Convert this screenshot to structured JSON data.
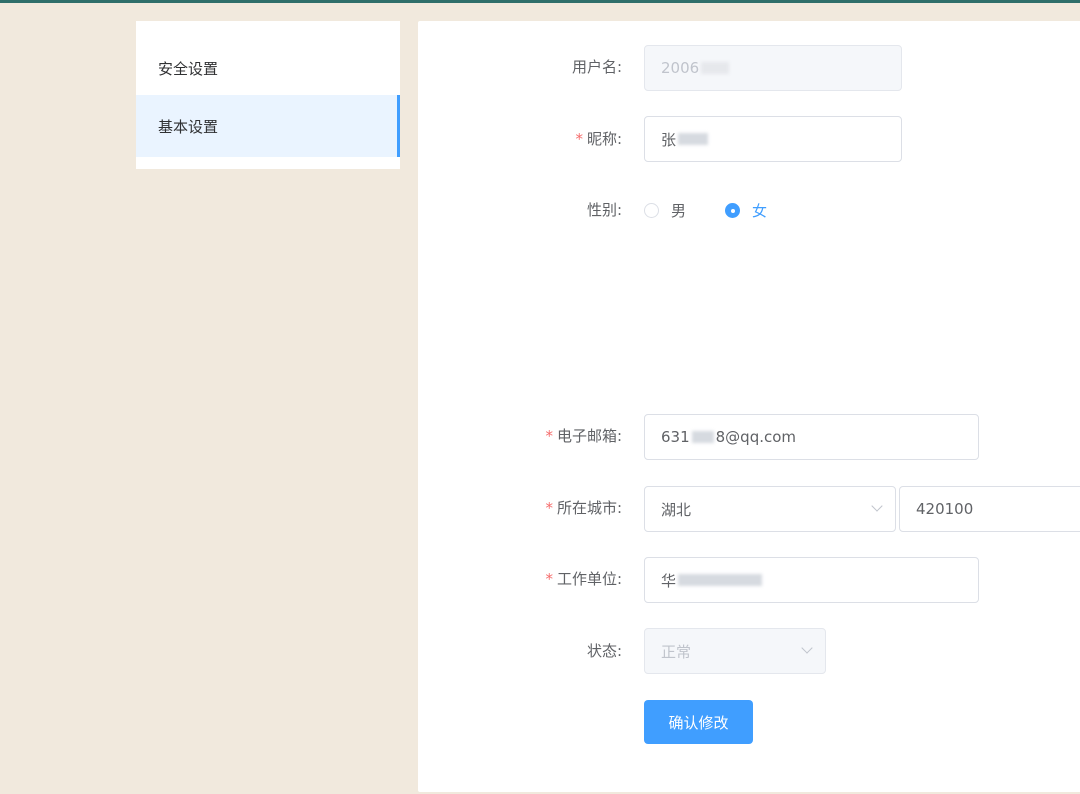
{
  "sidebar": {
    "items": [
      {
        "label": "安全设置"
      },
      {
        "label": "基本设置"
      }
    ]
  },
  "form": {
    "username": {
      "label": "用户名:",
      "value": "2006"
    },
    "nickname": {
      "label": "昵称:",
      "value": "张"
    },
    "gender": {
      "label": "性别:",
      "options": [
        "男",
        "女"
      ],
      "selected": "女"
    },
    "email": {
      "label": "电子邮箱:",
      "value_prefix": "631",
      "value_suffix": "8@qq.com"
    },
    "city": {
      "label": "所在城市:",
      "province": "湖北",
      "code": "420100"
    },
    "workplace": {
      "label": "工作单位:",
      "value": "华"
    },
    "status": {
      "label": "状态:",
      "value": "正常"
    },
    "submit_label": "确认修改"
  },
  "colors": {
    "page_bg": "#f1e9dd",
    "accent": "#409eff",
    "required_star": "#f56c6c"
  }
}
